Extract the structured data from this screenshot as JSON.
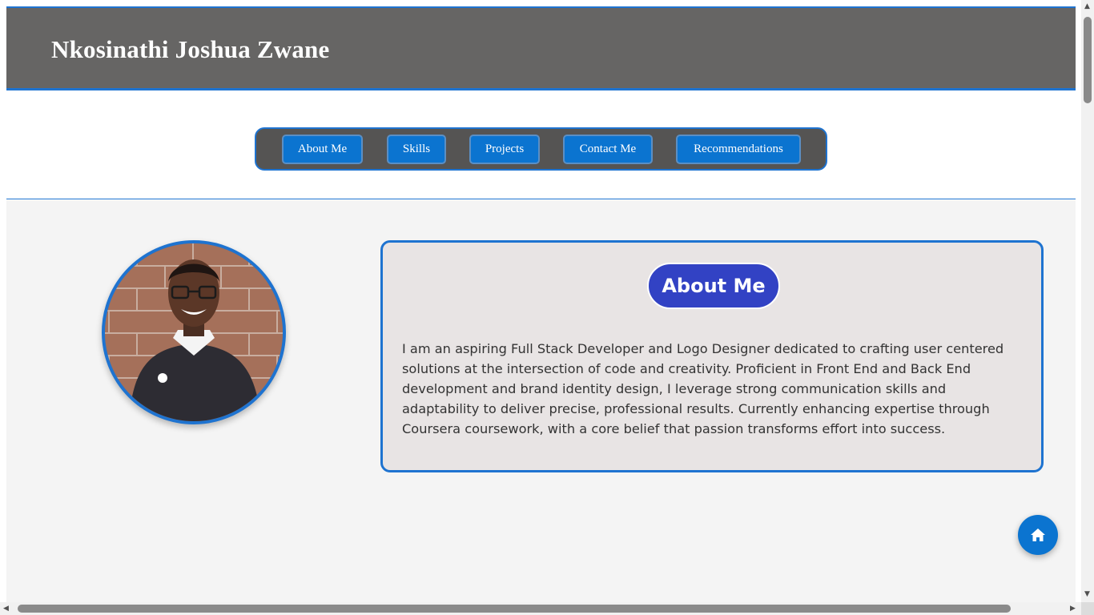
{
  "header": {
    "title": "Nkosinathi Joshua Zwane"
  },
  "nav": {
    "items": [
      {
        "label": "About Me"
      },
      {
        "label": "Skills"
      },
      {
        "label": "Projects"
      },
      {
        "label": "Contact Me"
      },
      {
        "label": "Recommendations"
      }
    ]
  },
  "about": {
    "heading": "About Me",
    "body": "I am an aspiring Full Stack Developer and Logo Designer dedicated to crafting user centered solutions at the intersection of code and creativity. Proficient in Front End and Back End development and brand identity design, I leverage strong communication skills and adaptability to deliver precise, professional results. Currently enhancing expertise through Coursera coursework, with a core belief that passion transforms effort into success."
  },
  "home_button": {
    "icon": "home-icon"
  },
  "colors": {
    "accent": "#1e73d0",
    "header_bg": "#666564",
    "button_bg": "#0b74d0",
    "heading_pill": "#3242c4"
  }
}
